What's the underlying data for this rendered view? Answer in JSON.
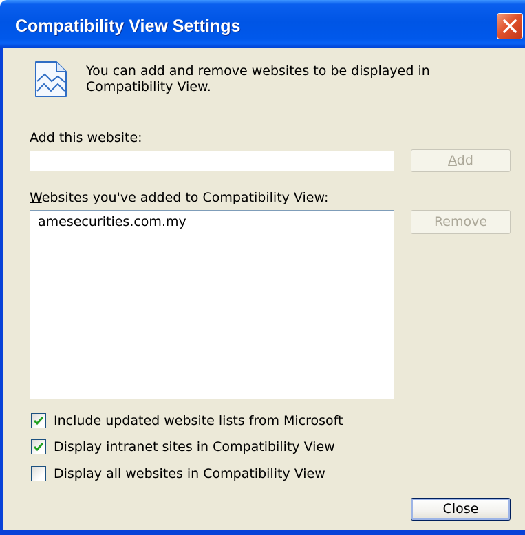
{
  "colors": {
    "title_bar": "#0055E5",
    "frame": "#0842D8",
    "dialog_bg": "#ECE9D8",
    "close_btn": "#E0522B",
    "field_border": "#7F9DB9",
    "checkbox_border": "#1C5180",
    "checkmark": "#21A121",
    "disabled_text": "#ACA899"
  },
  "window": {
    "title": "Compatibility View Settings",
    "close_icon": "close-icon"
  },
  "intro": {
    "icon": "webpage-icon",
    "line1": "You can add and remove websites to be displayed in",
    "line2": "Compatibility View."
  },
  "add_website": {
    "label": {
      "pre": "A",
      "key": "d",
      "post": "d this website:"
    },
    "input_value": "",
    "add_button": {
      "key": "A",
      "post": "dd",
      "disabled": true
    }
  },
  "website_list": {
    "label": {
      "key": "W",
      "post": "ebsites you've added to Compatibility View:"
    },
    "items": [
      "amesecurities.com.my"
    ],
    "remove_button": {
      "key": "R",
      "post": "emove",
      "disabled": true
    }
  },
  "options": [
    {
      "pre": "Include ",
      "key": "u",
      "post": "pdated website lists from Microsoft",
      "checked": true
    },
    {
      "pre": "Display ",
      "key": "i",
      "post": "ntranet sites in Compatibility View",
      "checked": true
    },
    {
      "pre": "Display all w",
      "key": "e",
      "post": "bsites in Compatibility View",
      "checked": false
    }
  ],
  "close_button": {
    "key": "C",
    "post": "lose"
  }
}
